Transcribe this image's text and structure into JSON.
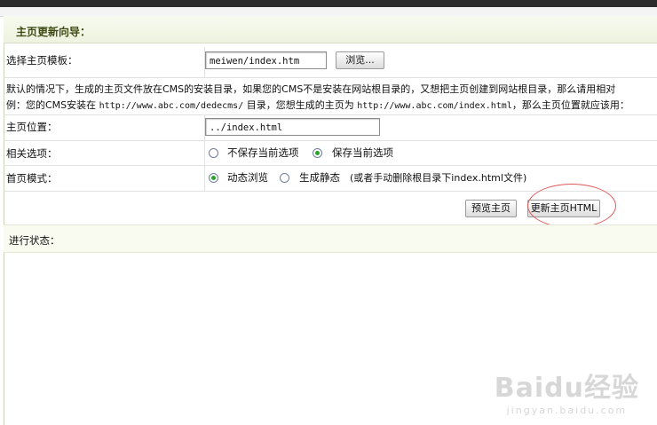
{
  "header": {
    "title": "主页更新向导："
  },
  "template_row": {
    "label": "选择主页模板：",
    "value": "meiwen/index.htm",
    "browse_label": "浏览..."
  },
  "notes": {
    "line1": "默认的情况下，生成的主页文件放在CMS的安装目录，如果您的CMS不是安装在网站根目录的，又想把主页创建到网站根目录，那么请用相对",
    "line2_a": "例：您的CMS安装在 ",
    "line2_url1": "http://www.abc.com/dedecms/",
    "line2_b": " 目录，您想生成的主页为 ",
    "line2_url2": "http://www.abc.com/index.html",
    "line2_c": "，那么主页位置就应该用："
  },
  "position_row": {
    "label": "主页位置：",
    "value": "../index.html"
  },
  "options_row": {
    "label": "相关选项：",
    "option1": "不保存当前选项",
    "option2": "保存当前选项",
    "selected": "option2"
  },
  "mode_row": {
    "label": "首页模式：",
    "option1": "动态浏览",
    "option2": "生成静态",
    "hint": "(或者手动删除根目录下index.html文件)",
    "selected": "option1"
  },
  "actions": {
    "preview_label": "预览主页",
    "update_label": "更新主页HTML"
  },
  "status": {
    "label": "进行状态："
  },
  "watermark": {
    "main": "Baidu经验",
    "sub": "jingyan.baidu.com"
  },
  "colors": {
    "title_text": "#3e4b14",
    "radio_fill": "#2aa32a",
    "highlight_ellipse": "#e25a5a"
  }
}
